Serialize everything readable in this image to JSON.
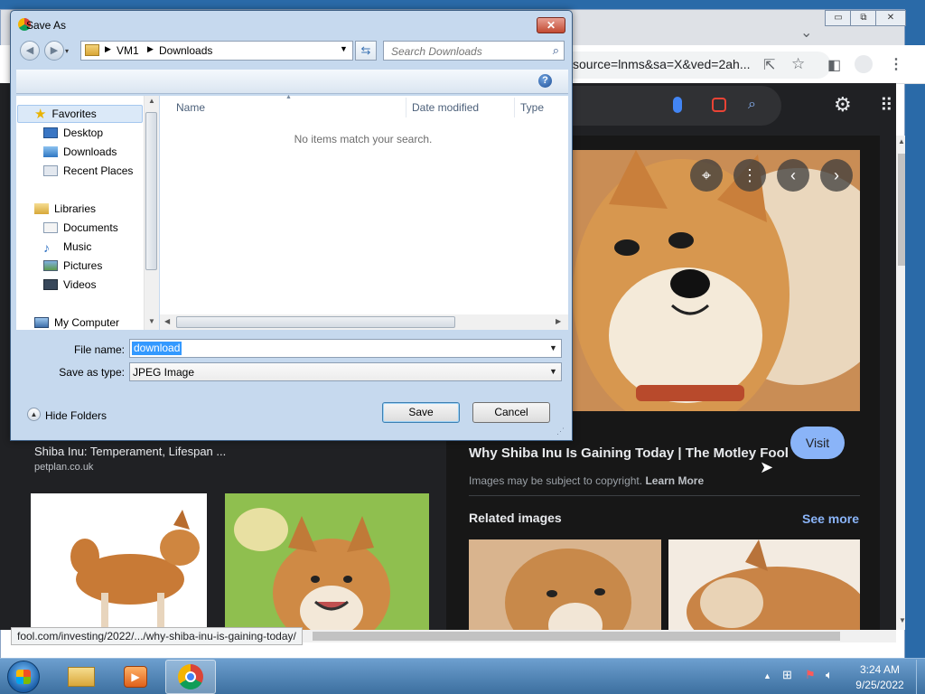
{
  "browser": {
    "window_controls": [
      "▭",
      "⧉",
      "✕"
    ],
    "omnibox_text": "source=lnms&sa=X&ved=2ah...",
    "image_viewer": {
      "title": "Why Shiba Inu Is Gaining Today | The Motley Fool",
      "visit_label": "Visit",
      "copyright_text": "Images may be subject to copyright.",
      "learn_more": "Learn More",
      "related_title": "Related images",
      "see_more": "See more"
    },
    "left_result": {
      "title": "Shiba Inu: Temperament, Lifespan ...",
      "source": "petplan.co.uk"
    },
    "status_url": "fool.com/investing/2022/.../why-shiba-inu-is-gaining-today/"
  },
  "dialog": {
    "title": "Save As",
    "close_label": "✕",
    "breadcrumb": [
      "VM1",
      "Downloads"
    ],
    "search_placeholder": "Search Downloads",
    "nav_groups": [
      {
        "label": "Favorites",
        "items": [
          "Desktop",
          "Downloads",
          "Recent Places"
        ]
      },
      {
        "label": "Libraries",
        "items": [
          "Documents",
          "Music",
          "Pictures",
          "Videos"
        ]
      },
      {
        "label": "My Computer",
        "items": []
      }
    ],
    "columns": [
      "Name",
      "Date modified",
      "Type"
    ],
    "empty_message": "No items match your search.",
    "file_name_label": "File name:",
    "file_name_value": "download",
    "save_type_label": "Save as type:",
    "save_type_value": "JPEG Image",
    "hide_folders_label": "Hide Folders",
    "save_label": "Save",
    "cancel_label": "Cancel"
  },
  "taskbar": {
    "time": "3:24 AM",
    "date": "9/25/2022"
  },
  "colors": {
    "dialog_frame": "#c6d9ee",
    "selection": "#3399ff",
    "google_dark": "#202124",
    "visit_button": "#8ab4f8"
  }
}
